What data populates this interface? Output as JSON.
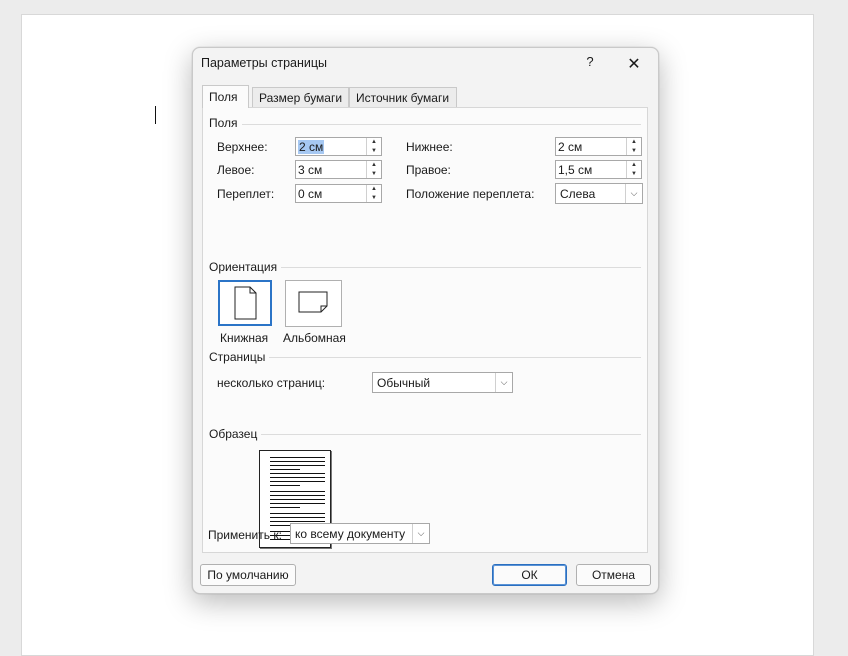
{
  "dialog": {
    "title": "Параметры страницы",
    "help": "?",
    "close": "✕"
  },
  "tabs": [
    "Поля",
    "Размер бумаги",
    "Источник бумаги"
  ],
  "margins": {
    "group": "Поля",
    "top_label": "Верхнее:",
    "top_value": "2 см",
    "left_label": "Левое:",
    "left_value": "3 см",
    "gutter_label": "Переплет:",
    "gutter_value": "0 см",
    "bottom_label": "Нижнее:",
    "bottom_value": "2 см",
    "right_label": "Правое:",
    "right_value": "1,5 см",
    "gutter_pos_label": "Положение переплета:",
    "gutter_pos_value": "Слева"
  },
  "orientation": {
    "group": "Ориентация",
    "portrait": "Книжная",
    "landscape": "Альбомная",
    "selected": "portrait"
  },
  "pages": {
    "group": "Страницы",
    "multiple_label": "несколько страниц:",
    "multiple_value": "Обычный"
  },
  "preview": {
    "group": "Образец"
  },
  "apply": {
    "label": "Применить к:",
    "value": "ко всему документу"
  },
  "buttons": {
    "default": "По умолчанию",
    "ok": "ОК",
    "cancel": "Отмена"
  },
  "icons": {
    "spin_up": "up-arrow-icon",
    "spin_down": "down-arrow-icon",
    "dropdown": "chevron-down-icon"
  },
  "colors": {
    "selection": "#a6c8f2",
    "accent": "#2b74c7"
  }
}
